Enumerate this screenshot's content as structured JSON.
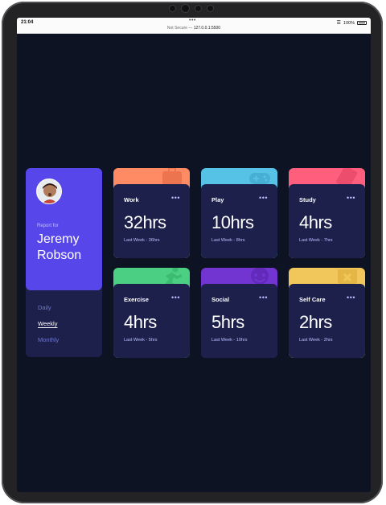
{
  "statusbar": {
    "time": "21:04",
    "dots": "•••",
    "security": "Not Secure —",
    "host": "127.0.0.1:5500",
    "battery": "100%"
  },
  "profile": {
    "report_for": "Report for",
    "first_name": "Jeremy",
    "last_name": "Robson",
    "periods": [
      "Daily",
      "Weekly",
      "Monthly"
    ],
    "active_period": "Weekly"
  },
  "cards": [
    {
      "title": "Work",
      "hours": "32hrs",
      "previous": "Last Week - 36hrs",
      "color": "#ff8b64",
      "icon": "work-icon"
    },
    {
      "title": "Play",
      "hours": "10hrs",
      "previous": "Last Week - 8hrs",
      "color": "#55c2e6",
      "icon": "play-icon"
    },
    {
      "title": "Study",
      "hours": "4hrs",
      "previous": "Last Week - 7hrs",
      "color": "#ff5e7d",
      "icon": "study-icon"
    },
    {
      "title": "Exercise",
      "hours": "4hrs",
      "previous": "Last Week - 5hrs",
      "color": "#4bcf82",
      "icon": "exercise-icon"
    },
    {
      "title": "Social",
      "hours": "5hrs",
      "previous": "Last Week - 10hrs",
      "color": "#7335d2",
      "icon": "social-icon"
    },
    {
      "title": "Self Care",
      "hours": "2hrs",
      "previous": "Last Week - 2hrs",
      "color": "#f1c75b",
      "icon": "self-care-icon"
    }
  ],
  "colors": {
    "background": "#0d1323",
    "card": "#1c204b",
    "profile": "#5747ea",
    "muted_text": "#bbc0ff"
  }
}
